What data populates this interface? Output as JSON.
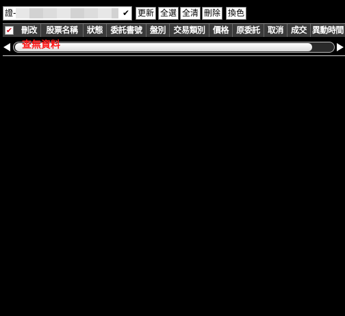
{
  "toolbar": {
    "account_prefix": "證-",
    "account_dropdown_chevron": "✔",
    "refresh_label": "更新",
    "select_all_label": "全選",
    "clear_all_label": "全清",
    "delete_label": "刪除",
    "change_color_label": "換色"
  },
  "table": {
    "select_all_check": "✔",
    "columns": [
      "刪改",
      "股票名稱",
      "狀態",
      "委託書號",
      "盤別",
      "交易類別",
      "價格",
      "原委託",
      "取消",
      "成交",
      "異動時間"
    ]
  },
  "empty_message": "查無資料",
  "colors": {
    "background": "#000000",
    "header_background": "#3a3a3a",
    "empty_message": "#ff1a1a",
    "check_mark": "#d01020"
  }
}
